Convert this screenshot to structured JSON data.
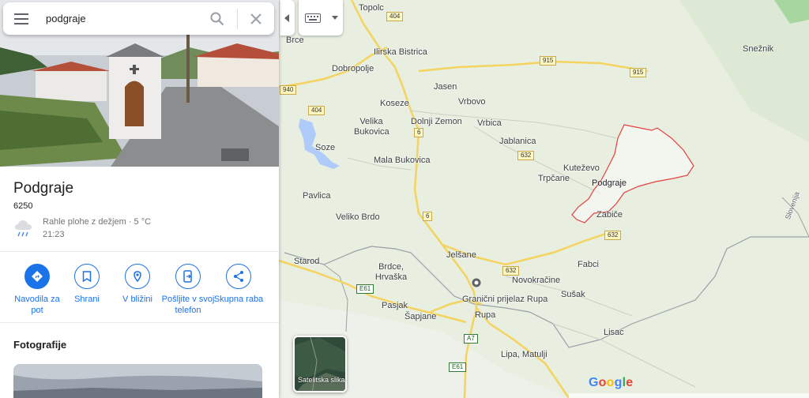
{
  "search": {
    "value": "podgraje"
  },
  "place": {
    "name": "Podgraje",
    "postal": "6250"
  },
  "weather": {
    "condition": "Rahle plohe z dežjem · 5 °C",
    "time": "21:23",
    "icon": "rain-cloud-icon"
  },
  "actions": [
    {
      "label": "Navodila za pot",
      "icon": "directions-icon"
    },
    {
      "label": "Shrani",
      "icon": "bookmark-icon"
    },
    {
      "label": "V bližini",
      "icon": "nearby-icon"
    },
    {
      "label": "Pošljite v svoj telefon",
      "icon": "send-to-phone-icon"
    },
    {
      "label": "Skupna raba",
      "icon": "share-icon"
    }
  ],
  "photos_title": "Fotografije",
  "satellite_label": "Satelitska slika",
  "logo": "Google",
  "colors": {
    "accent": "#1a73e8",
    "boundary": "#e34040",
    "map_bg": "#e9efe2"
  },
  "map": {
    "places": [
      "Topolc",
      "Ilirska Bistrica",
      "Brce",
      "Dobropolje",
      "Jasen",
      "Koseze",
      "Vrbovo",
      "Velika Bukovica",
      "Dolnji Zemon",
      "Vrbica",
      "Soze",
      "Jablanica",
      "Mala Bukovica",
      "Kuteževo",
      "Trpčane",
      "Podgraje",
      "Pavlica",
      "Zabiče",
      "Veliko Brdo",
      "Jelšane",
      "Fabci",
      "Starod",
      "Brdce, Hrvaška",
      "Novokračine",
      "Pasjak",
      "Sušak",
      "Šapjane",
      "Granični prijelaz Rupa",
      "Rupa",
      "Lisac",
      "Lipa, Matulji",
      "Snežnik",
      "Slovenija"
    ],
    "roads": [
      "404",
      "404",
      "915",
      "915",
      "940",
      "6",
      "6",
      "632",
      "632",
      "632",
      "E61",
      "A7",
      "E61"
    ]
  }
}
